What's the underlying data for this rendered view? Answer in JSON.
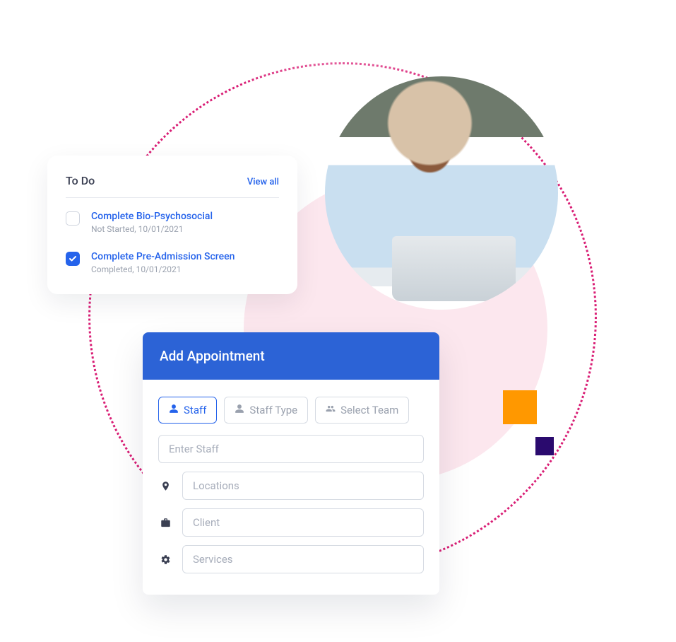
{
  "todo": {
    "title": "To Do",
    "view_all": "View all",
    "items": [
      {
        "label": "Complete Bio-Psychosocial",
        "sub": "Not Started, 10/01/2021",
        "checked": false
      },
      {
        "label": "Complete Pre-Admission Screen",
        "sub": "Completed, 10/01/2021",
        "checked": true
      }
    ]
  },
  "appointment": {
    "title": "Add Appointment",
    "tabs": {
      "staff": "Staff",
      "staff_type": "Staff Type",
      "select_team": "Select Team"
    },
    "placeholders": {
      "enter_staff": "Enter Staff",
      "locations": "Locations",
      "client": "Client",
      "services": "Services"
    }
  },
  "colors": {
    "primary": "#2c63d6",
    "link": "#2563eb",
    "dotted": "#d91e75",
    "pink": "#fce7ee",
    "orange": "#ff9800",
    "indigo": "#2a0a6e"
  }
}
